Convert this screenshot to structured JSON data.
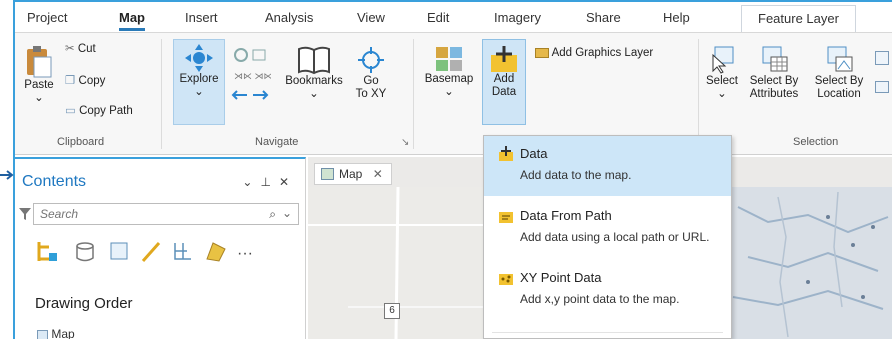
{
  "tabs": [
    "Project",
    "Map",
    "Insert",
    "Analysis",
    "View",
    "Edit",
    "Imagery",
    "Share",
    "Help"
  ],
  "active_tab": "Map",
  "context_tab": "Feature Layer",
  "clipboard": {
    "paste": "Paste",
    "cut": "Cut",
    "copy": "Copy",
    "copy_path": "Copy Path",
    "group": "Clipboard"
  },
  "navigate": {
    "explore": "Explore",
    "bookmarks": "Bookmarks",
    "goto_line1": "Go",
    "goto_line2": "To XY",
    "group": "Navigate"
  },
  "layer": {
    "basemap": "Basemap",
    "add_line1": "Add",
    "add_line2": "Data",
    "add_graphics": "Add Graphics Layer"
  },
  "selection": {
    "select": "Select",
    "by_attr_line1": "Select By",
    "by_attr_line2": "Attributes",
    "by_loc_line1": "Select By",
    "by_loc_line2": "Location",
    "group": "Selection"
  },
  "contents": {
    "title": "Contents",
    "search_placeholder": "Search",
    "drawing_order": "Drawing Order",
    "map_layer": "Map"
  },
  "map_tab": "Map",
  "route_label": "6",
  "dropdown": [
    {
      "title": "Data",
      "desc": "Add data to the map."
    },
    {
      "title": "Data From Path",
      "desc": "Add data using a local path or URL."
    },
    {
      "title": "XY Point Data",
      "desc": "Add x,y point data to the map."
    }
  ],
  "colors": {
    "accent": "#3aa0dc",
    "highlight": "#cde6f8",
    "title_blue": "#1f78c1"
  }
}
